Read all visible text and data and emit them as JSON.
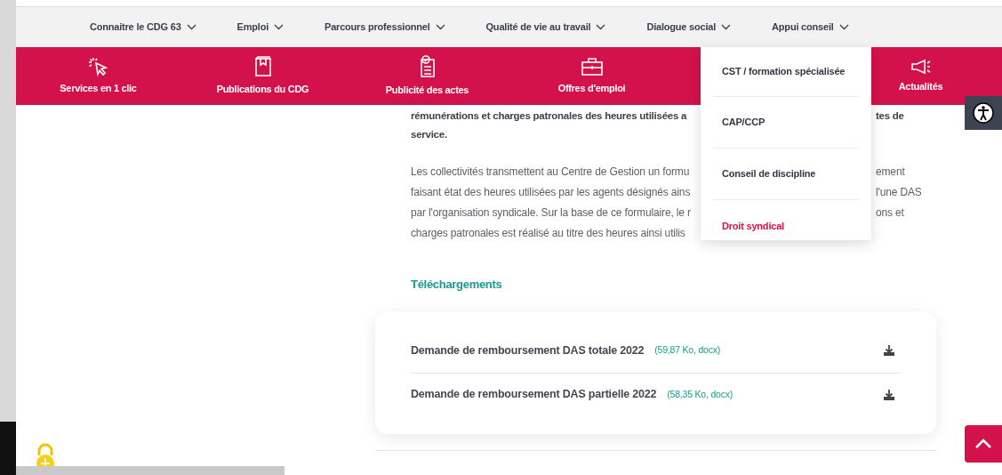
{
  "top_nav": [
    {
      "label": "Connaitre le CDG 63"
    },
    {
      "label": "Emploi"
    },
    {
      "label": "Parcours professionnel"
    },
    {
      "label": "Qualité de vie au travail"
    },
    {
      "label": "Dialogue social"
    },
    {
      "label": "Appui conseil"
    }
  ],
  "quick_links": [
    {
      "label": "Services en 1 clic",
      "kind": "pointer"
    },
    {
      "label": "Publications du CDG",
      "kind": "book"
    },
    {
      "label": "Publicité des actes",
      "kind": "document"
    },
    {
      "label": "Offres d'emploi",
      "kind": "briefcase"
    },
    {
      "kind": "hidden"
    },
    {
      "label": "Actualités",
      "kind": "megaphone"
    }
  ],
  "dropdown": [
    {
      "label": "CST / formation spécialisée",
      "selected": false
    },
    {
      "label": "CAP/CCP",
      "selected": false
    },
    {
      "label": "Conseil de discipline",
      "selected": false
    },
    {
      "label": "Droit syndical",
      "selected": true
    }
  ],
  "article": [
    {
      "kind": "lead",
      "left": "rémunérations et charges patronales des heures utilisées a",
      "right": "tes de"
    },
    {
      "kind": "lead",
      "left": "service."
    },
    {
      "kind": "body",
      "left": "Les collectivités transmettent au Centre de Gestion un formu",
      "right": "ement"
    },
    {
      "kind": "body",
      "left": "faisant état des heures utilisées par les agents désignés ains",
      "right": "l'une DAS"
    },
    {
      "kind": "body",
      "left": "par l'organisation syndicale. Sur la base de ce formulaire, le r",
      "right": "ons et"
    },
    {
      "kind": "body",
      "left": "charges patronales est réalisé au titre des heures ainsi utilis"
    }
  ],
  "downloads": {
    "heading": "Téléchargements",
    "files": [
      {
        "title": "Demande de remboursement DAS totale 2022",
        "meta": "(59,87 Ko, docx)"
      },
      {
        "title": "Demande de remboursement DAS partielle 2022",
        "meta": "(58,35 Ko, docx)"
      }
    ]
  }
}
